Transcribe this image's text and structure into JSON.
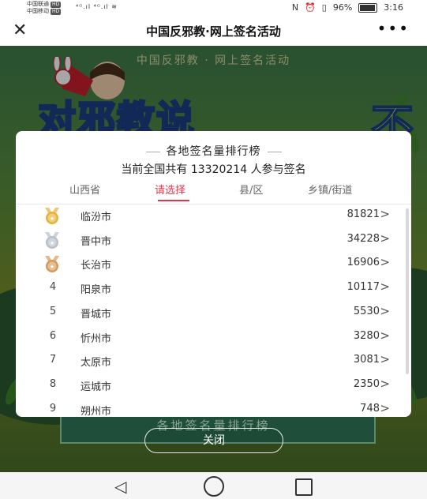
{
  "status_bar": {
    "carrier1": "中国联通",
    "carrier2": "中国移动",
    "hd": "HD",
    "signal": "⁴ᴳ.ıl ⁴ᴳ.ıl ≋",
    "nfc": "N",
    "alarm": "⏰",
    "vibrate": "▯",
    "battery": "96%",
    "time": "3:16"
  },
  "titlebar": {
    "title": "中国反邪教·网上签名活动",
    "more": "•••"
  },
  "background": {
    "header": "中国反邪教 · 网上签名活动",
    "banner": "对邪教说",
    "banner_cross": "不",
    "under_text": "各地签名量排行榜"
  },
  "modal": {
    "title": "各地签名量排行榜",
    "summary": "当前全国共有 13320214 人参与签名",
    "tabs": [
      "山西省",
      "请选择",
      "县/区",
      "乡镇/街道"
    ],
    "rows": [
      {
        "rank": "1",
        "name": "临汾市",
        "value": "81821",
        "medal": "gold"
      },
      {
        "rank": "2",
        "name": "晋中市",
        "value": "34228",
        "medal": "silver"
      },
      {
        "rank": "3",
        "name": "长治市",
        "value": "16906",
        "medal": "bronze"
      },
      {
        "rank": "4",
        "name": "阳泉市",
        "value": "10117"
      },
      {
        "rank": "5",
        "name": "晋城市",
        "value": "5530"
      },
      {
        "rank": "6",
        "name": "忻州市",
        "value": "3280"
      },
      {
        "rank": "7",
        "name": "太原市",
        "value": "3081"
      },
      {
        "rank": "8",
        "name": "运城市",
        "value": "2350"
      },
      {
        "rank": "9",
        "name": "朔州市",
        "value": "748"
      }
    ],
    "chevron": ">"
  },
  "close_button": "关闭",
  "colors": {
    "accent": "#e0364a",
    "gold": "#e4b43a",
    "silver": "#b9c0cc",
    "bronze": "#d79a5a"
  },
  "nav": {
    "back": "◁"
  }
}
